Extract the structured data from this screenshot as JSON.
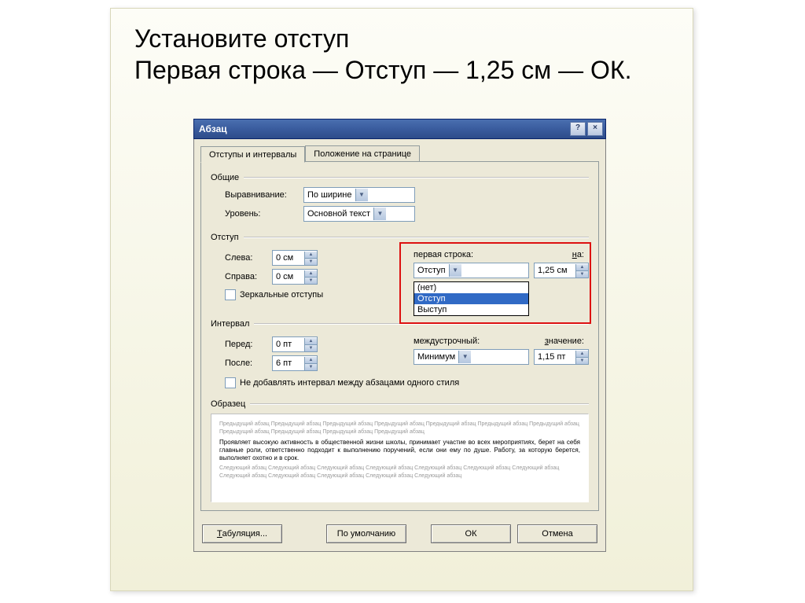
{
  "instruction": {
    "line1": "Установите отступ",
    "line2": "Первая строка — Отступ — 1,25 см — ОК."
  },
  "titlebar": {
    "title": "Абзац"
  },
  "tabs": {
    "active": "Отступы и интервалы",
    "inactive": "Положение на странице"
  },
  "general": {
    "heading": "Общие",
    "align_label": "Выравнивание:",
    "align_value": "По ширине",
    "level_label": "Уровень:",
    "level_value": "Основной текст"
  },
  "indent": {
    "heading": "Отступ",
    "left_label": "Слева:",
    "left_value": "0 см",
    "right_label": "Справа:",
    "right_value": "0 см",
    "mirror_label": "Зеркальные отступы",
    "firstline_label": "первая строка:",
    "firstline_value": "Отступ",
    "by_label": "на:",
    "by_value": "1,25 см",
    "options": {
      "none": "(нет)",
      "indent": "Отступ",
      "outdent": "Выступ"
    }
  },
  "spacing": {
    "heading": "Интервал",
    "before_label": "Перед:",
    "before_value": "0 пт",
    "after_label": "После:",
    "after_value": "6 пт",
    "linespacing_label": "междустрочный:",
    "linespacing_value": "Минимум",
    "at_label": "значение:",
    "at_value": "1,15 пт",
    "nosame_label": "Не добавлять интервал между абзацами одного стиля"
  },
  "preview": {
    "heading": "Образец",
    "prev": "Предыдущий абзац Предыдущий абзац Предыдущий абзац Предыдущий абзац Предыдущий абзац Предыдущий абзац Предыдущий абзац Предыдущий абзац Предыдущий абзац Предыдущий абзац Предыдущий абзац",
    "main": "Проявляет высокую активность в общественной жизни школы, принимает участие во всех мероприятиях, берет на себя главные роли, ответственно подходит к выполнению поручений, если они ему по душе. Работу, за которую берется, выполняет охотно и в срок.",
    "next": "Следующий абзац Следующий абзац Следующий абзац Следующий абзац Следующий абзац Следующий абзац Следующий абзац Следующий абзац Следующий абзац Следующий абзац Следующий абзац Следующий абзац"
  },
  "buttons": {
    "tabs": "Табуляция...",
    "default": "По умолчанию",
    "ok": "ОК",
    "cancel": "Отмена"
  }
}
